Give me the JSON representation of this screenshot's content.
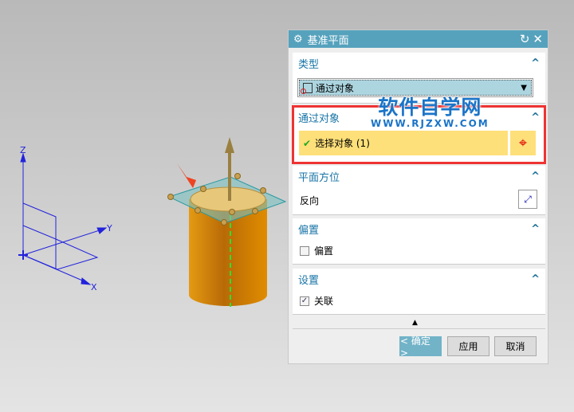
{
  "viewport": {
    "axis_x": "X",
    "axis_y": "Y",
    "axis_z": "Z"
  },
  "dialog": {
    "title": "基准平面",
    "type_section": {
      "label": "类型",
      "selected": "通过对象"
    },
    "object_section": {
      "label": "通过对象",
      "select_label": "选择对象 (1)"
    },
    "orientation_section": {
      "label": "平面方位",
      "reverse_label": "反向"
    },
    "offset_section": {
      "label": "偏置",
      "checkbox_label": "偏置",
      "checked": false
    },
    "settings_section": {
      "label": "设置",
      "checkbox_label": "关联",
      "checked": true
    },
    "buttons": {
      "ok": "< 确定 >",
      "apply": "应用",
      "cancel": "取消"
    }
  },
  "watermark": {
    "title": "软件自学网",
    "url": "WWW.RJZXW.COM"
  },
  "colors": {
    "title_bar": "#56a2bd",
    "highlight": "#fee07a",
    "accent": "#1874a6"
  }
}
